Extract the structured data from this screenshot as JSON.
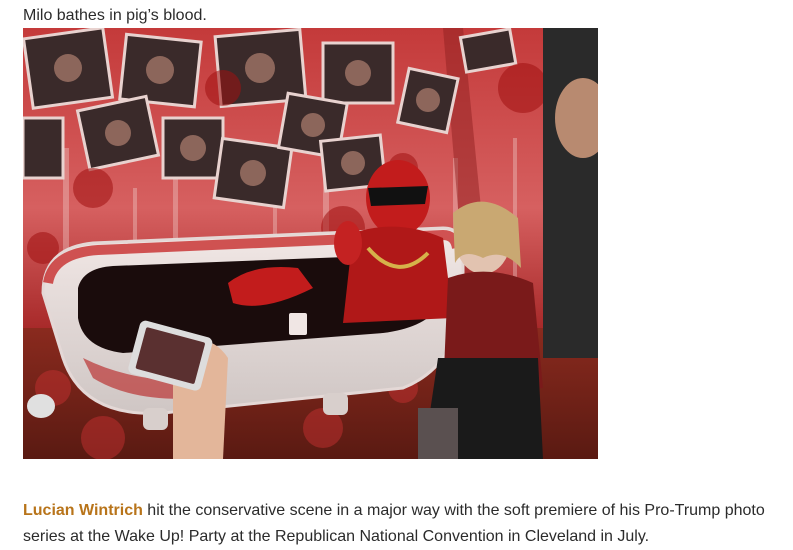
{
  "caption": "Milo bathes in pig’s blood.",
  "photo_alt": "",
  "paragraph": {
    "link_text": "Lucian Wintrich",
    "body_text": " hit the conservative scene in a major way with the soft premiere of his Pro-Trump photo series at the Wake Up! Party at the Republican National Convention in Cleveland in July."
  },
  "colors": {
    "link": "#b8741a",
    "text": "#2b2b2b",
    "blood": "#b01818"
  }
}
